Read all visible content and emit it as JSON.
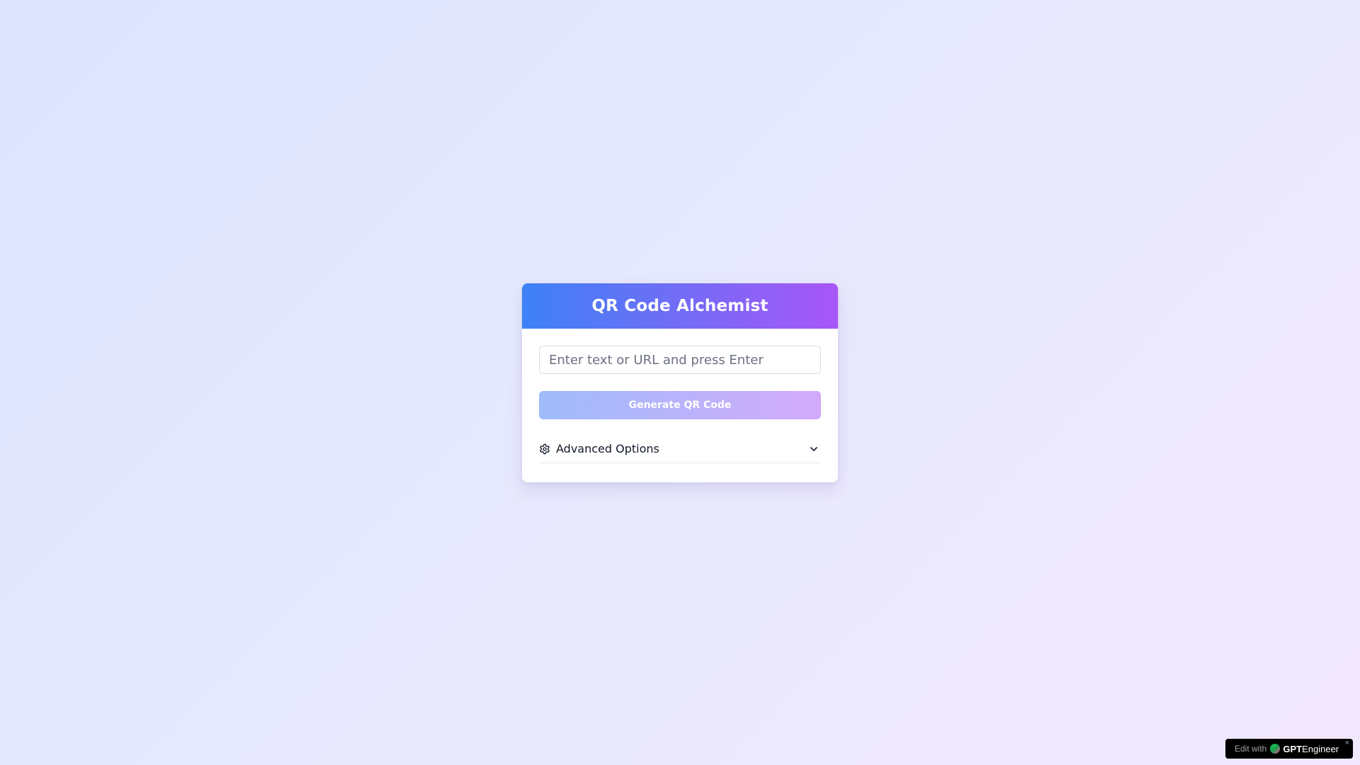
{
  "app": {
    "title": "QR Code Alchemist"
  },
  "input": {
    "placeholder": "Enter text or URL and press Enter",
    "value": ""
  },
  "generate_button": {
    "label": "Generate QR Code",
    "enabled": false
  },
  "advanced_options": {
    "label": "Advanced Options",
    "icon": "gear-icon",
    "toggle_icon": "chevron-down-icon",
    "expanded": false
  },
  "badge": {
    "prefix": "Edit with",
    "brand_bold": "GPT",
    "brand_rest": "Engineer",
    "close_glyph": "×"
  },
  "colors": {
    "header_gradient_start": "#3d82f6",
    "header_gradient_end": "#a856f7",
    "button_gradient_start": "#9fbcfb",
    "button_gradient_end": "#d3aafb",
    "page_background_start": "#dde6fe",
    "page_background_end": "#f2e8fe"
  }
}
